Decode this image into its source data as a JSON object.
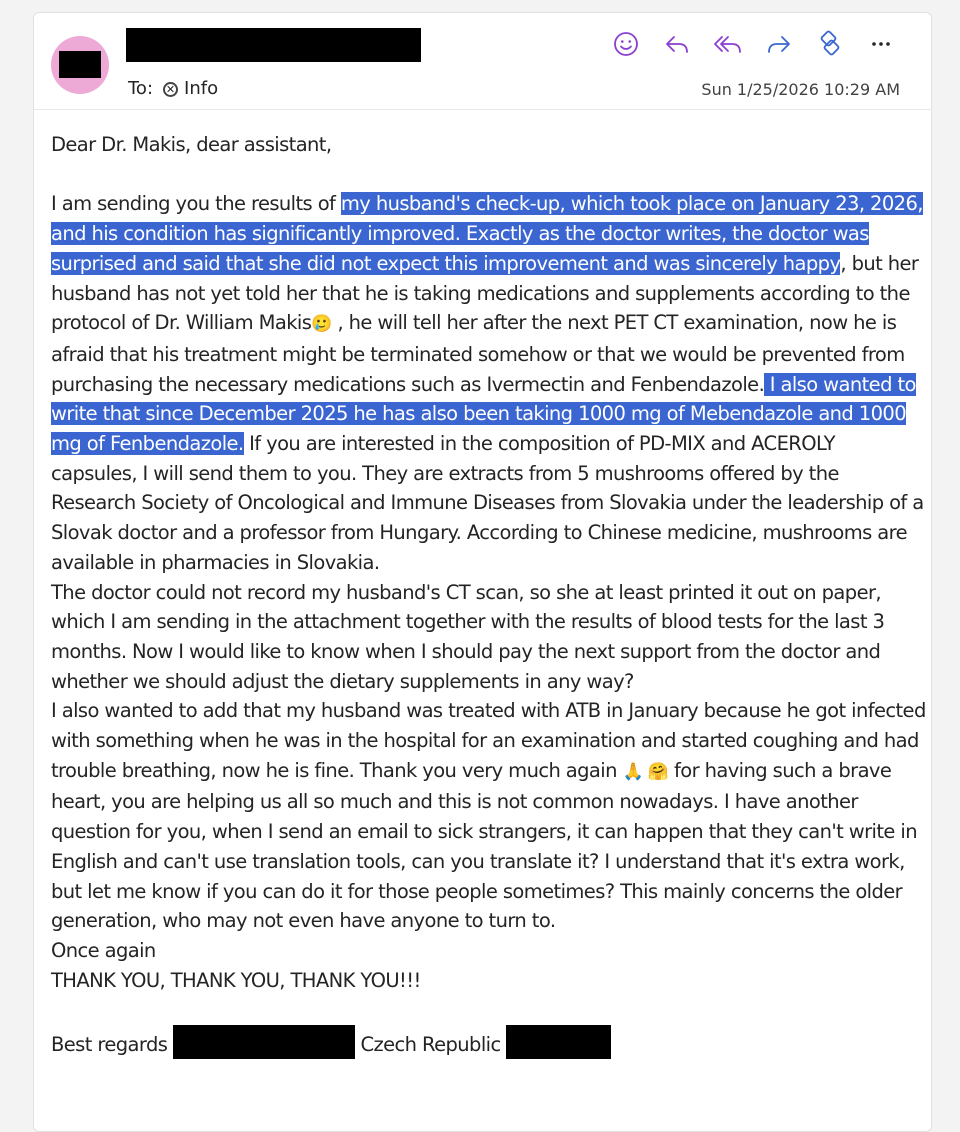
{
  "header": {
    "to_label": "To:",
    "recipient": "Info",
    "date": "Sun 1/25/2026 10:29 AM",
    "actions": [
      {
        "name": "emoji-icon",
        "color": "#8a3fd1"
      },
      {
        "name": "reply-icon",
        "color": "#8a3fd1"
      },
      {
        "name": "reply-all-icon",
        "color": "#8a3fd1"
      },
      {
        "name": "forward-icon",
        "color": "#3b66d1"
      },
      {
        "name": "loop-icon",
        "color": "#3b66d1"
      },
      {
        "name": "more-icon",
        "color": "#242424"
      }
    ]
  },
  "colors": {
    "avatar": "#eeaad6",
    "highlight": "#3b66d1"
  },
  "body": {
    "greeting": "Dear Dr. Makis, dear assistant,",
    "p1_a": "I am sending you the results of ",
    "p1_hl1": "my husband's check-up, which took place on January 23, 2026, and his condition has significantly improved. Exactly as the doctor writes, the doctor was surprised and said that she did not expect this improvement and was sincerely happy",
    "p1_b": ", but her husband has not yet told her that he is taking medications and supplements according to the protocol of Dr. William Makis",
    "p1_emoji1": "🥲",
    "p1_c": " , he will tell her after the next PET CT examination, now he is afraid that his treatment might be terminated somehow or that we would be prevented from purchasing the necessary medications such as Ivermectin and Fenbendazole.",
    "p1_hl2": " I also wanted to write that since December 2025 he has also been taking 1000 mg of Mebendazole and 1000 mg of Fenbendazole.",
    "p1_d": " If you are interested in the composition of PD-MIX and ACEROLY capsules, I will send them to you. They are extracts from 5 mushrooms offered by the Research Society of Oncological and Immune Diseases from Slovakia under the leadership of a Slovak doctor and a professor from Hungary. According to Chinese medicine, mushrooms are available in pharmacies in Slovakia.",
    "p2": "The doctor could not record my husband's CT scan, so she at least printed it out on paper, which I am sending in the attachment together with the results of blood tests for the last 3 months. Now I would like to know when I should pay the next support from the doctor and whether we should adjust the dietary supplements in any way?",
    "p3_a": "I also wanted to add that my husband was treated with ATB in January because he got infected with something when he was in the hospital for an examination and started coughing and had trouble breathing, now he is fine. Thank you very much again ",
    "p3_emoji": "🙏 🤗",
    "p3_b": " for having such a brave heart, you are helping us all so much and this is not common nowadays. I have another question for you, when I send an email to sick strangers, it can happen that they can't write in English and can't use translation tools, can you translate it? I understand that it's extra work, but let me know if you can do it for those people sometimes? This mainly concerns the older generation, who may not even have anyone to turn to.",
    "once_again": "Once again",
    "thanks": "THANK YOU, THANK YOU, THANK YOU!!!",
    "regards": "Best regards ",
    "country": " Czech Republic "
  }
}
